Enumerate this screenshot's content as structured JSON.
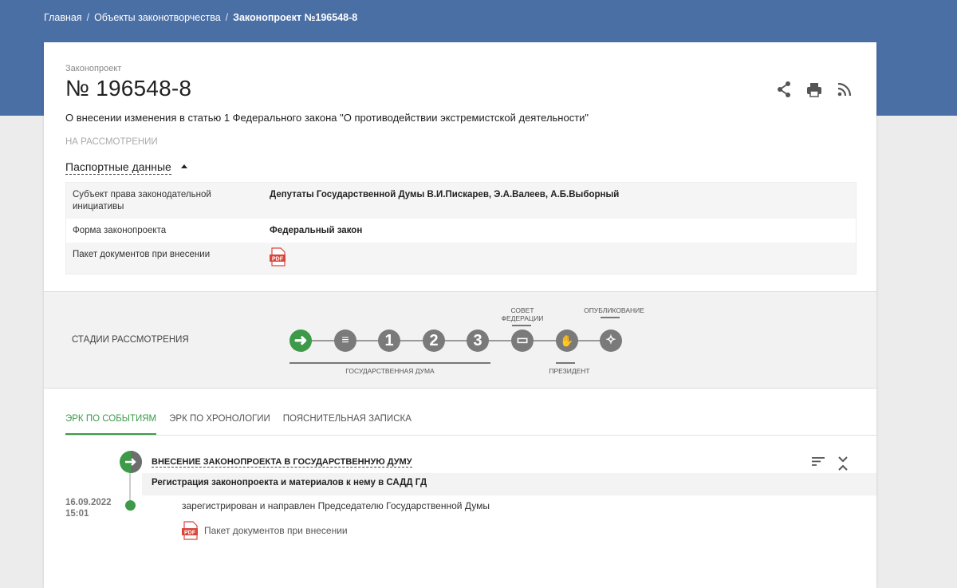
{
  "breadcrumb": {
    "items": [
      "Главная",
      "Объекты законотворчества",
      "Законопроект №196548-8"
    ],
    "separator": "/"
  },
  "bill": {
    "type_label": "Законопроект",
    "number": "№ 196548-8",
    "title": "О внесении изменения в статью 1 Федерального закона \"О противодействии экстремистской деятельности\"",
    "status": "НА РАССМОТРЕНИИ"
  },
  "actions": {
    "share_icon": "share-icon",
    "print_icon": "printer-icon",
    "rss_icon": "rss-icon"
  },
  "passport": {
    "toggle_label": "Паспортные данные",
    "rows": [
      {
        "label": "Субъект права законодательной инициативы",
        "value": "Депутаты Государственной Думы В.И.Пискарев, Э.А.Валеев, А.Б.Выборный"
      },
      {
        "label": "Форма законопроекта",
        "value": "Федеральный закон"
      },
      {
        "label": "Пакет документов при внесении",
        "value": ""
      }
    ],
    "pdf_label": "PDF"
  },
  "stages": {
    "title": "СТАДИИ РАССМОТРЕНИЯ",
    "items": [
      {
        "glyph": "➜",
        "active": true
      },
      {
        "glyph": "≡",
        "active": false
      },
      {
        "glyph": "1",
        "active": false
      },
      {
        "glyph": "2",
        "active": false
      },
      {
        "glyph": "3",
        "active": false
      },
      {
        "glyph": "▭",
        "active": false
      },
      {
        "glyph": "✋",
        "active": false
      },
      {
        "glyph": "✧",
        "active": false
      }
    ],
    "label_duma": "ГОСУДАРСТВЕННАЯ ДУМА",
    "label_council_line1": "СОВЕТ",
    "label_council_line2": "ФЕДЕРАЦИИ",
    "label_president": "ПРЕЗИДЕНТ",
    "label_published": "ОПУБЛИКОВАНИЕ"
  },
  "tabs": [
    "ЭРК ПО СОБЫТИЯМ",
    "ЭРК ПО ХРОНОЛОГИИ",
    "ПОЯСНИТЕЛЬНАЯ ЗАПИСКА"
  ],
  "active_tab": 0,
  "event": {
    "heading": "ВНЕСЕНИЕ ЗАКОНОПРОЕКТА В ГОСУДАРСТВЕННУЮ ДУМУ",
    "subheading": "Регистрация законопроекта и материалов к нему в САДД ГД",
    "date": "16.09.2022",
    "time": "15:01",
    "text": "зарегистрирован и направлен Председателю Государственной Думы",
    "doc_label": "Пакет документов при внесении"
  },
  "colors": {
    "header": "#4a6fa5",
    "accent_green": "#3c9a48",
    "pdf_red": "#d9463b"
  }
}
